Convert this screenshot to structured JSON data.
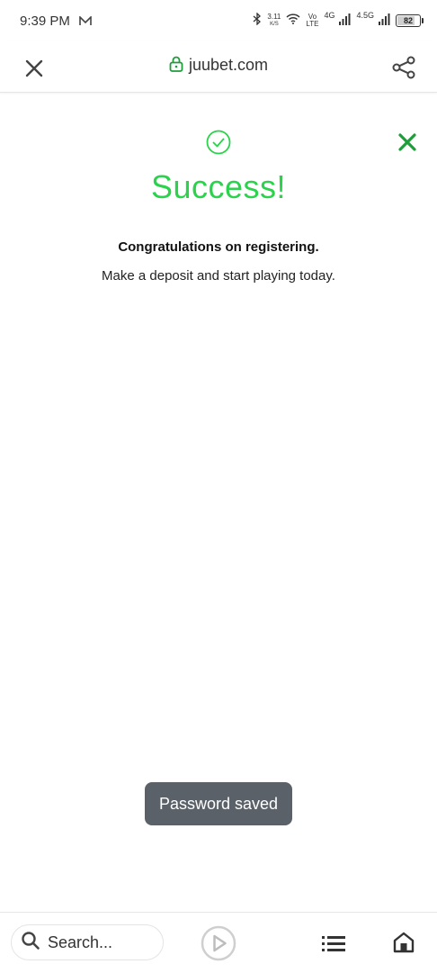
{
  "status_bar": {
    "time": "9:39 PM",
    "speed_value": "3.11",
    "speed_unit": "K/S",
    "volte_top": "Vo",
    "volte_bottom": "LTE",
    "network1": "4G",
    "network2": "4.5G",
    "battery": "82",
    "battery_level": 0.82
  },
  "browser": {
    "url": "juubet.com"
  },
  "page": {
    "title": "Success!",
    "congrats": "Congratulations on registering.",
    "subtext": "Make a deposit and start playing today.",
    "accent_color": "#2bd24b"
  },
  "toast": {
    "text": "Password saved"
  },
  "bottom_bar": {
    "search_placeholder": "Search..."
  },
  "icons": [
    "mail-icon",
    "bluetooth-icon",
    "wifi-icon",
    "signal-icon",
    "battery-icon",
    "close-icon",
    "lock-icon",
    "share-icon",
    "success-check-icon",
    "dismiss-x-icon",
    "search-icon",
    "play-icon",
    "menu-icon",
    "home-icon"
  ]
}
